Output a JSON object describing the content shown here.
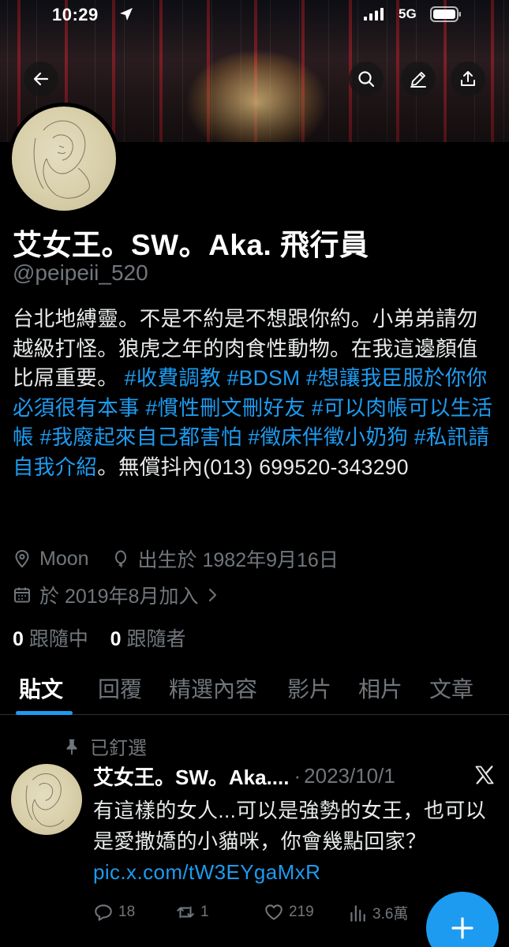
{
  "status_bar": {
    "time": "10:29",
    "network": "5G"
  },
  "profile": {
    "display_name": "艾女王。SW。Aka. 飛行員",
    "handle": "@peipeii_520",
    "bio": [
      {
        "text": "台北地縛靈。不是不約是不想跟你約。小弟弟請勿越級打怪。狼虎之年的肉食性動物。在我這邊顏值比屌重要。 ",
        "tag": false
      },
      {
        "text": "#收費調教",
        "tag": true
      },
      {
        "text": " ",
        "tag": false
      },
      {
        "text": "#BDSM",
        "tag": true
      },
      {
        "text": " ",
        "tag": false
      },
      {
        "text": "#想讓我臣服於你你必須很有本事",
        "tag": true
      },
      {
        "text": " ",
        "tag": false
      },
      {
        "text": "#慣性刪文刪好友",
        "tag": true
      },
      {
        "text": " ",
        "tag": false
      },
      {
        "text": "#可以肉帳可以生活帳",
        "tag": true
      },
      {
        "text": " ",
        "tag": false
      },
      {
        "text": "#我廢起來自己都害怕",
        "tag": true
      },
      {
        "text": " ",
        "tag": false
      },
      {
        "text": "#徵床伴徵小奶狗",
        "tag": true
      },
      {
        "text": " ",
        "tag": false
      },
      {
        "text": "#私訊請自我介紹",
        "tag": true
      },
      {
        "text": "。無償抖內(013) 699520-343290",
        "tag": false
      }
    ],
    "location": "Moon",
    "birthday": "出生於 1982年9月16日",
    "joined": "於 2019年8月加入",
    "following_count": "0",
    "following_label": "跟隨中",
    "followers_count": "0",
    "followers_label": "跟隨者"
  },
  "tabs": [
    {
      "label": "貼文",
      "active": true
    },
    {
      "label": "回覆",
      "active": false
    },
    {
      "label": "精選內容",
      "active": false
    },
    {
      "label": "影片",
      "active": false
    },
    {
      "label": "相片",
      "active": false
    },
    {
      "label": "文章",
      "active": false
    }
  ],
  "pinned_tweet": {
    "pinned_label": "已釘選",
    "author_name": "艾女王。SW。Aka....",
    "separator": "·",
    "date": "2023/10/1",
    "text": "有這樣的女人...可以是強勢的女王，也可以是愛撒嬌的小貓咪，你會幾點回家？",
    "link": "pic.x.com/tW3EYgaMxR",
    "replies": "18",
    "retweets": "1",
    "likes": "219",
    "views": "3.6萬"
  },
  "colors": {
    "accent": "#1d9bf0",
    "muted": "#71767b",
    "background": "#000000"
  }
}
